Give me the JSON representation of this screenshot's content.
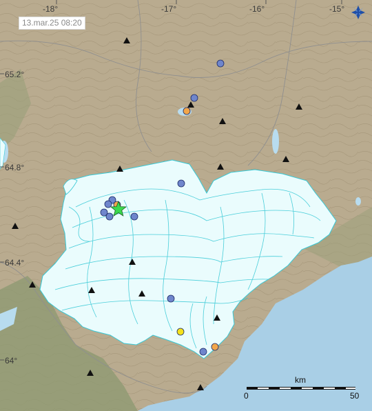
{
  "map": {
    "timestamp": "13.mar.25  08:20",
    "colors": {
      "land": "#b9ab8f",
      "highland": "#a89878",
      "lowland": "#8f9a72",
      "glacier": "#eafcfd",
      "glacier_contour": "#37c9d6",
      "sea": "#a9cfe6",
      "lake": "#b8dcef",
      "earthquake_old": "#6f86cc",
      "earthquake_recent": "#f2a64a",
      "earthquake_new": "#f5e21c",
      "largest_star": "#3bd94d",
      "volcano_marker": "#111111"
    },
    "longitude_labels": [
      "-18°",
      "-17°",
      "-16°",
      "-15°"
    ],
    "latitude_labels": [
      "65.2°",
      "64.8°",
      "64.4°",
      "64°"
    ],
    "scale": {
      "unit": "km",
      "start": "0",
      "end": "50"
    },
    "logo_icon": "compass-star-logo-icon",
    "volcano_icon": "triangle-icon",
    "star_icon": "star-icon"
  }
}
